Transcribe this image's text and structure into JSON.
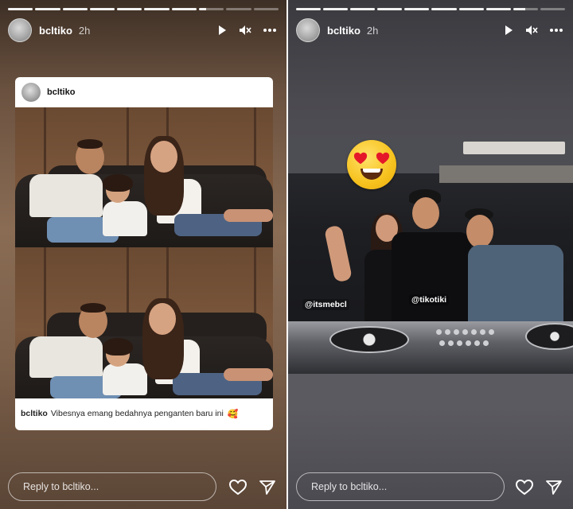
{
  "stories": [
    {
      "username": "bcltiko",
      "time": "2h",
      "progress_segments": 10,
      "active_segment": 8,
      "active_segment_fraction": 0.3,
      "card": {
        "username": "bcltiko",
        "caption_user": "bcltiko",
        "caption_text": "Vibesnya emang bedahnya penganten baru ini",
        "caption_emoji": "🥰"
      },
      "reply_placeholder": "Reply to bcltiko..."
    },
    {
      "username": "bcltiko",
      "time": "2h",
      "progress_segments": 10,
      "active_segment": 9,
      "active_segment_fraction": 0.5,
      "tags": [
        "@itsmebcl",
        "@tikotiki"
      ],
      "reply_placeholder": "Reply to bcltiko..."
    }
  ],
  "icons": {
    "play": "play-icon",
    "mute": "mute-icon",
    "more": "more-icon",
    "like": "heart-icon",
    "share": "send-icon",
    "sticker": "heart-eyes-emoji"
  },
  "colors": {
    "left_bg": "#7c604a",
    "right_bg": "#59585e",
    "text": "#ffffff"
  }
}
